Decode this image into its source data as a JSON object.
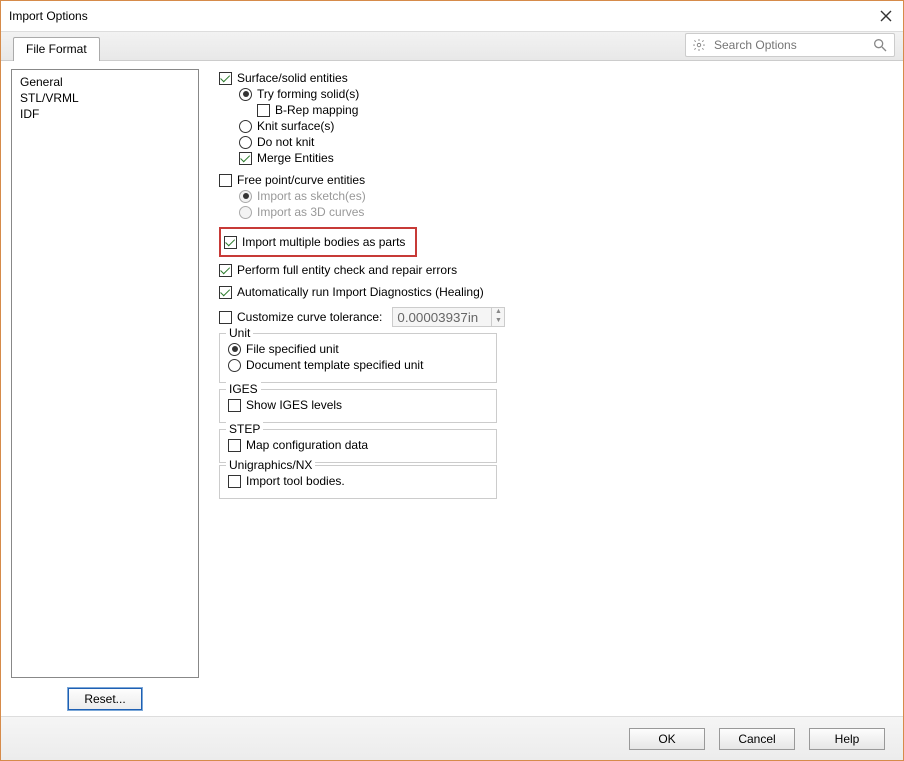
{
  "title": "Import Options",
  "tab": "File Format",
  "search": {
    "placeholder": "Search Options"
  },
  "categories": [
    "General",
    "STL/VRML",
    "IDF"
  ],
  "reset": "Reset...",
  "opts": {
    "surface": "Surface/solid entities",
    "tryForm": "Try forming solid(s)",
    "brep": "B-Rep mapping",
    "knit": "Knit surface(s)",
    "donotknit": "Do not knit",
    "merge": "Merge Entities",
    "freePts": "Free point/curve entities",
    "impSketch": "Import as sketch(es)",
    "imp3d": "Import as 3D curves",
    "multibody": "Import multiple bodies as parts",
    "fullcheck": "Perform full entity check and repair errors",
    "diag": "Automatically run Import Diagnostics (Healing)",
    "custTol": "Customize curve tolerance:",
    "tolVal": "0.00003937in",
    "unit": "Unit",
    "unitFile": "File specified unit",
    "unitDoc": "Document template specified unit",
    "iges": "IGES",
    "igesLevels": "Show IGES levels",
    "step": "STEP",
    "stepMap": "Map configuration data",
    "ug": "Unigraphics/NX",
    "ugTool": "Import tool bodies."
  },
  "buttons": {
    "ok": "OK",
    "cancel": "Cancel",
    "help": "Help"
  }
}
